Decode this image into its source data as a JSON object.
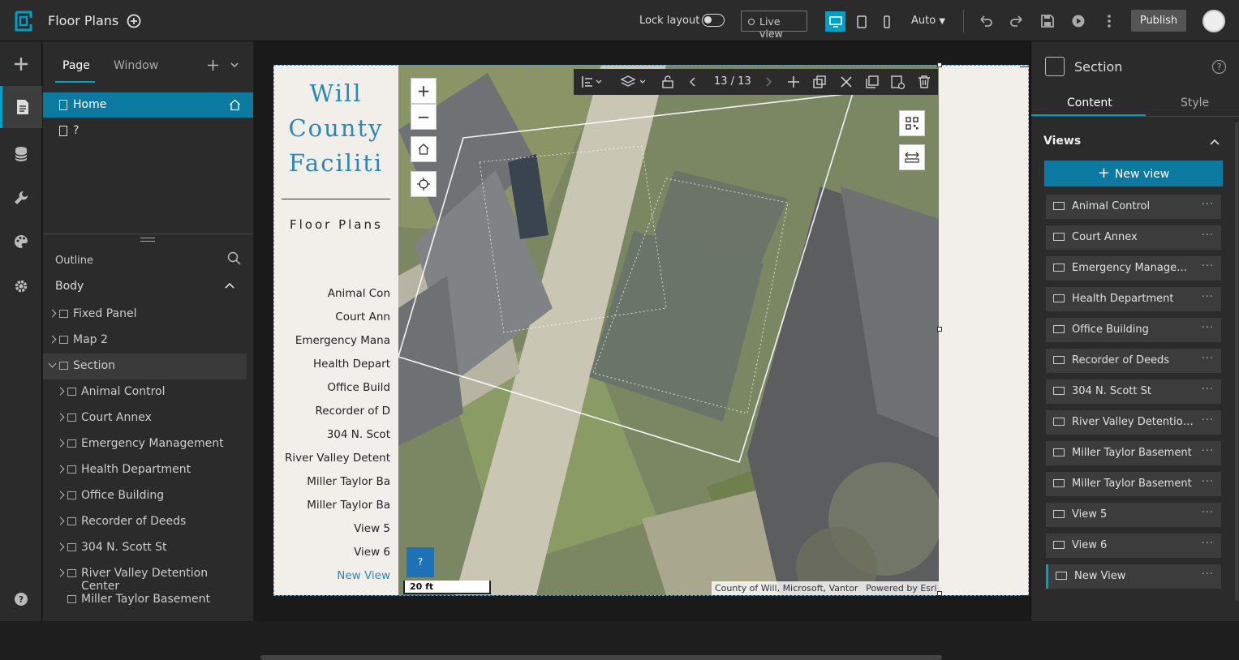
{
  "app": {
    "title": "Floor Plans"
  },
  "topbar": {
    "lock_layout": "Lock layout",
    "live_view": "Live view",
    "auto": "Auto",
    "publish": "Publish"
  },
  "page_panel": {
    "tabs": [
      "Page",
      "Window"
    ],
    "pages": [
      {
        "label": "Home",
        "active": true
      },
      {
        "label": "?",
        "active": false
      }
    ],
    "outline_title": "Outline",
    "body_label": "Body",
    "tree": [
      {
        "label": "Fixed Panel",
        "level": 1,
        "expanded": false,
        "icon": "fixed-panel-icon"
      },
      {
        "label": "Map 2",
        "level": 1,
        "expanded": false,
        "icon": "map-icon"
      },
      {
        "label": "Section",
        "level": 1,
        "expanded": true,
        "icon": "section-icon",
        "selected": true
      },
      {
        "label": "Animal Control",
        "level": 2,
        "expanded": false,
        "icon": "view-icon"
      },
      {
        "label": "Court Annex",
        "level": 2,
        "expanded": false,
        "icon": "view-icon"
      },
      {
        "label": "Emergency Management",
        "level": 2,
        "expanded": false,
        "icon": "view-icon"
      },
      {
        "label": "Health Department",
        "level": 2,
        "expanded": false,
        "icon": "view-icon"
      },
      {
        "label": "Office Building",
        "level": 2,
        "expanded": false,
        "icon": "view-icon"
      },
      {
        "label": "Recorder of Deeds",
        "level": 2,
        "expanded": false,
        "icon": "view-icon"
      },
      {
        "label": "304 N. Scott St",
        "level": 2,
        "expanded": false,
        "icon": "view-icon"
      },
      {
        "label": "River Valley Detention Center",
        "level": 2,
        "expanded": false,
        "icon": "view-icon"
      },
      {
        "label": "Miller Taylor Basement",
        "level": 2,
        "expanded": null,
        "icon": "view-icon"
      }
    ]
  },
  "side_panel": {
    "title_lines": [
      "Will",
      "County",
      "Faciliti"
    ],
    "subtitle": "Floor Plans",
    "links": [
      "Animal Con",
      "Court Ann",
      "Emergency Mana",
      "Health Depart",
      "Office Build",
      "Recorder of D",
      "304 N. Scot",
      "River Valley Detent",
      "Miller Taylor Ba",
      "Miller Taylor Ba",
      "View 5",
      "View 6",
      "New View"
    ]
  },
  "map": {
    "page_count": "13 / 13",
    "scale": "20 ft",
    "attribution": "County of Will, Microsoft, Vantor",
    "powered_by": "Powered by Esri",
    "help": "?"
  },
  "right_panel": {
    "title": "Section",
    "tabs": [
      "Content",
      "Style"
    ],
    "views_title": "Views",
    "new_view": "New view",
    "views": [
      {
        "label": "Animal Control"
      },
      {
        "label": "Court Annex"
      },
      {
        "label": "Emergency Managem..."
      },
      {
        "label": "Health Department"
      },
      {
        "label": "Office Building"
      },
      {
        "label": "Recorder of Deeds"
      },
      {
        "label": "304 N. Scott St"
      },
      {
        "label": "River Valley Detention..."
      },
      {
        "label": "Miller Taylor Basement"
      },
      {
        "label": "Miller Taylor Basement"
      },
      {
        "label": "View 5"
      },
      {
        "label": "View 6"
      },
      {
        "label": "New View",
        "active": true
      }
    ]
  },
  "colors": {
    "accent": "#00a0c6",
    "selected": "#0c7aa0",
    "title_blue": "#2a87b8"
  }
}
